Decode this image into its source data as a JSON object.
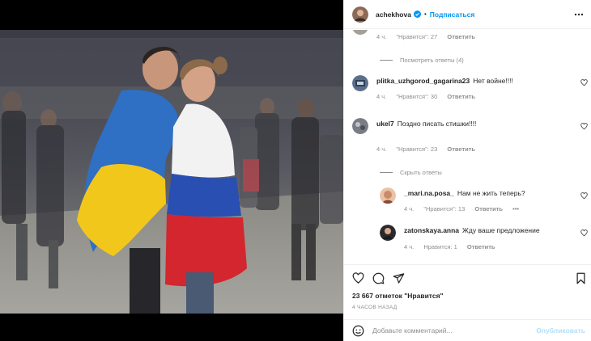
{
  "header": {
    "username": "achekhova",
    "separator": "•",
    "follow_label": "Подписаться",
    "verified_icon": "verified-badge-icon",
    "more_icon": "more-horizontal-icon"
  },
  "comments": {
    "top_meta": {
      "time": "4 ч.",
      "likes": "\"Нравится\": 27",
      "reply": "Ответить"
    },
    "view_replies": "Посмотреть ответы (4)",
    "items": [
      {
        "username": "plitka_uzhgorod_gagarina23",
        "text": "Нет войне!!!!",
        "time": "4 ч.",
        "likes": "\"Нравится\": 30",
        "reply": "Ответить"
      },
      {
        "username": "ukel7",
        "text": "Поздно писать стишки!!!! ",
        "time": "4 ч.",
        "likes": "\"Нравится\": 23",
        "reply": "Ответить"
      }
    ],
    "hide_replies": "Скрыть ответы",
    "replies": [
      {
        "username": "_mari.na.posa_",
        "text": "Нам не жить теперь?",
        "time": "4 ч.",
        "likes": "\"Нравится\": 13",
        "reply": "Ответить"
      },
      {
        "username": "zatonskaya.anna",
        "text": "Жду ваше предложение",
        "time": "4 ч.",
        "likes": "Нравится: 1",
        "reply": "Ответить"
      }
    ]
  },
  "actions": {
    "like_icon": "heart-icon",
    "comment_icon": "comment-icon",
    "share_icon": "paper-plane-icon",
    "save_icon": "bookmark-icon",
    "likes_text": "23 667 отметок \"Нравится\"",
    "time_ago": "4 ЧАСОВ НАЗАД"
  },
  "add_comment": {
    "emoji_icon": "smiley-icon",
    "placeholder": "Добавьте комментарий...",
    "publish_label": "Опубликовать"
  },
  "colors": {
    "accent": "#0095f6",
    "publish_disabled": "#b2dffc",
    "muted": "#8e8e8e",
    "text": "#262626"
  }
}
